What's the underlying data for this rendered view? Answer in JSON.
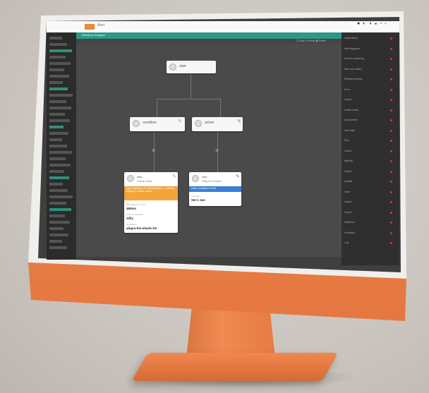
{
  "topbar": {
    "title": "Alert"
  },
  "os_icons": "● ◐ ◑ ◒ ▫ ▫",
  "tealbar": {
    "title": "Workflow Designer"
  },
  "subbar": {
    "links": "◫ Save   ◎ Reset   ▣ Delete"
  },
  "nodes": {
    "root": {
      "label": "start"
    },
    "left": {
      "label": "condition"
    },
    "right": {
      "label": "action"
    }
  },
  "cards": {
    "left": {
      "head": "step",
      "sub": "Check Data",
      "banner": "Input Validation & Transformation — Handle Missing / Invalid Values",
      "f1_label": "ERP Response Time",
      "f1_val": "460ms",
      "f2_label": "Alerts on Demand",
      "f2_val": "Affix",
      "f3_label": "Destination",
      "f3_val": "alegra-fee-elastic-k2"
    },
    "right": {
      "head": "step",
      "sub": "Output Creation",
      "banner": "Data Completion Field",
      "f1_label": "Last Run",
      "f1_val": "Set 1 Jan"
    }
  },
  "right_sidebar": [
    "Notifications",
    "Alert triggered",
    "Device monitoring",
    "New rule added",
    "Pipeline finished",
    "Error",
    "Queue",
    "Health check",
    "Deployment",
    "Sync task",
    "Run",
    "Cache",
    "Backup",
    "Report",
    "Update",
    "Scan",
    "Import",
    "Export",
    "Webhook",
    "Schedule",
    "Log"
  ],
  "colors": {
    "accent": "#2a9a86",
    "orange": "#f08a52",
    "card_orange": "#f3a53a",
    "card_blue": "#3a7fd6"
  }
}
